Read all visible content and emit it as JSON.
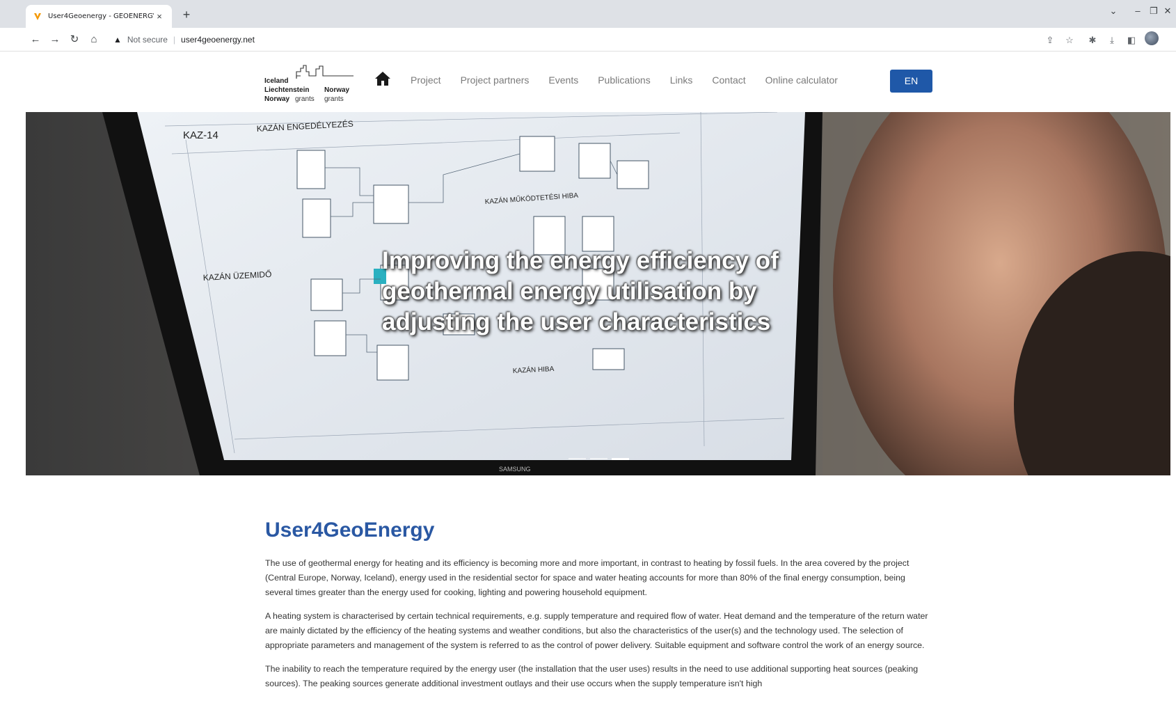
{
  "browser": {
    "tab_title": "User4Geoenergy - GEOENERGY",
    "tab_close": "×",
    "new_tab": "+",
    "window_controls": [
      "⌄",
      "–",
      "❐",
      "✕"
    ],
    "security_label": "Not secure",
    "url": "user4geoenergy.net"
  },
  "header": {
    "logo": {
      "line1": "Iceland",
      "line2a": "Liechtenstein",
      "line2b": "Norway",
      "line3a": "Norway",
      "line3b": "grants",
      "line3c": "grants"
    },
    "nav": [
      "Project",
      "Project partners",
      "Events",
      "Publications",
      "Links",
      "Contact",
      "Online calculator"
    ],
    "language_button": "EN"
  },
  "hero": {
    "title": "Improving the energy efficiency of geothermal energy utilisation by adjusting the user characteristics",
    "screen_labels": {
      "kaz14": "KAZ-14",
      "engedelyezes": "KAZÁN ENGEDÉLYEZÉS",
      "mukodtetesi": "KAZÁN MŰKÖDTETÉSI HIBA",
      "uzemido": "KAZÁN ÜZEMIDŐ",
      "hiba": "KAZÁN HIBA",
      "brand": "SAMSUNG"
    },
    "slides": 3,
    "active_slide": 3
  },
  "content": {
    "heading": "User4GeoEnergy",
    "paragraphs": [
      "The use of geothermal energy for heating and its efficiency is becoming more and more important, in contrast to heating by fossil fuels. In the area covered by the project (Central Europe, Norway, Iceland), energy used in the residential sector for space and water heating accounts for more than 80% of the final energy consumption, being several times greater than the energy used for cooking, lighting and powering household equipment.",
      "A heating system is characterised by certain technical requirements, e.g. supply temperature and required flow of water. Heat demand and the temperature of the return water are mainly dictated by the efficiency of the heating systems and weather conditions, but also the characteristics of the user(s) and the technology used. The selection of appropriate parameters and management of the system is referred to as the control of power delivery. Suitable equipment and software control the work of an energy source.",
      "The inability to reach the temperature required by the energy user (the installation that the user uses) results in the need to use additional supporting heat sources (peaking sources). The peaking sources generate additional investment outlays and their use occurs when the supply temperature isn't high"
    ]
  },
  "colors": {
    "accent": "#2a58a3",
    "button": "#1f58a8",
    "nav_text": "#7a7a7a"
  }
}
